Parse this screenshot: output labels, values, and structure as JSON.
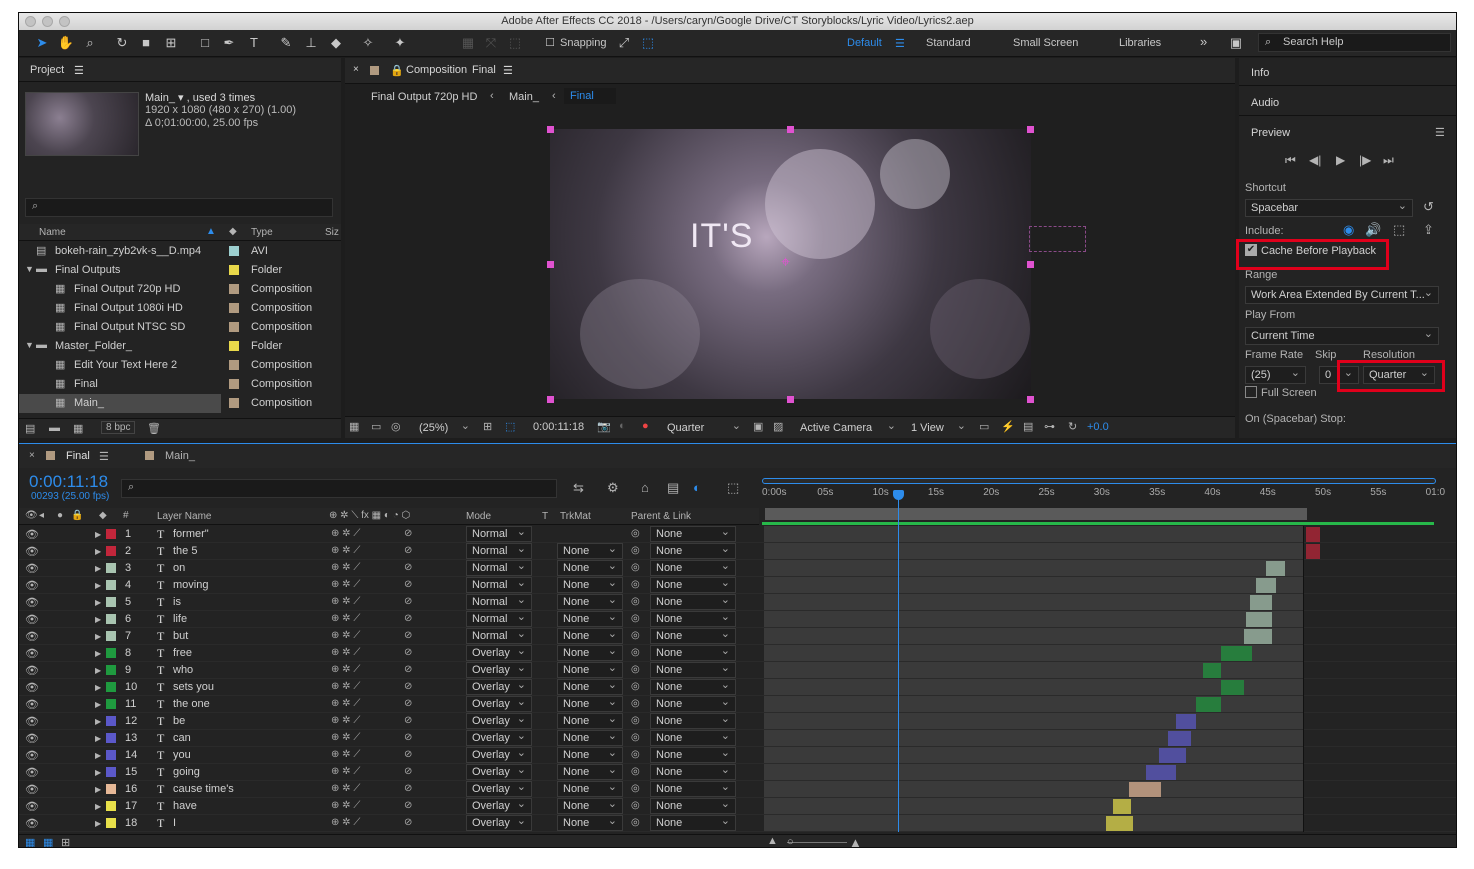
{
  "window": {
    "title": "Adobe After Effects CC 2018 - /Users/caryn/Google Drive/CT Storyblocks/Lyric Video/Lyrics2.aep"
  },
  "toolbar": {
    "snapping": "Snapping",
    "workspaces": [
      "Default",
      "Standard",
      "Small Screen",
      "Libraries"
    ],
    "more": "»",
    "search_placeholder": "Search Help"
  },
  "project": {
    "title": "Project",
    "item_name": "Main_ ▾ , used 3 times",
    "item_res": "1920 x 1080  (480 x 270) (1.00)",
    "item_dur": "Δ 0;01:00:00, 25.00 fps",
    "search": "",
    "col_name": "Name",
    "col_type": "Type",
    "col_size": "Siz",
    "items": [
      {
        "name": "bokeh-rain_zyb2vk-s__D.mp4",
        "type": "AVI",
        "color": "#9ccfcf",
        "indent": 0,
        "kind": "file"
      },
      {
        "name": "Final Outputs",
        "type": "Folder",
        "color": "#e8d84a",
        "indent": 0,
        "kind": "folder"
      },
      {
        "name": "Final Output 720p HD",
        "type": "Composition",
        "color": "#b09a80",
        "indent": 1,
        "kind": "comp"
      },
      {
        "name": "Final Output 1080i HD",
        "type": "Composition",
        "color": "#b09a80",
        "indent": 1,
        "kind": "comp"
      },
      {
        "name": "Final Output NTSC SD",
        "type": "Composition",
        "color": "#b09a80",
        "indent": 1,
        "kind": "comp"
      },
      {
        "name": "Master_Folder_",
        "type": "Folder",
        "color": "#e8d84a",
        "indent": 0,
        "kind": "folder"
      },
      {
        "name": "Edit Your Text Here 2",
        "type": "Composition",
        "color": "#b09a80",
        "indent": 1,
        "kind": "comp"
      },
      {
        "name": "Final",
        "type": "Composition",
        "color": "#b09a80",
        "indent": 1,
        "kind": "comp"
      },
      {
        "name": "Main_",
        "type": "Composition",
        "color": "#b09a80",
        "indent": 1,
        "kind": "comp"
      }
    ],
    "bpc": "8 bpc"
  },
  "comp": {
    "header": "Composition",
    "header_name": "Final",
    "breadcrumbs": [
      "Final Output 720p HD",
      "Main_",
      "Final"
    ],
    "overlay_text": "IT'S",
    "zoom": "(25%)",
    "timecode": "0:00:11:18",
    "resolution": "Quarter",
    "camera": "Active Camera",
    "views": "1 View",
    "exposure": "+0.0"
  },
  "right": {
    "info": "Info",
    "audio": "Audio",
    "preview": "Preview",
    "shortcut_label": "Shortcut",
    "shortcut": "Spacebar",
    "include": "Include:",
    "cache": "Cache Before Playback",
    "range_label": "Range",
    "range": "Work Area Extended By Current T...",
    "playfrom_label": "Play From",
    "playfrom": "Current Time",
    "framerate_label": "Frame Rate",
    "framerate": "(25)",
    "skip_label": "Skip",
    "skip": "0",
    "resolution_label": "Resolution",
    "resolution": "Quarter",
    "fullscreen": "Full Screen",
    "stop": "On (Spacebar) Stop:"
  },
  "timeline": {
    "tabs": [
      "Final",
      "Main_"
    ],
    "timecode": "0:00:11:18",
    "frames": "00293 (25.00 fps)",
    "col_layer": "Layer Name",
    "col_mode": "Mode",
    "col_t": "T",
    "col_trkmat": "TrkMat",
    "col_parent": "Parent & Link",
    "ruler": [
      "0:00s",
      "05s",
      "10s",
      "15s",
      "20s",
      "25s",
      "30s",
      "35s",
      "40s",
      "45s",
      "50s",
      "55s",
      "01:0"
    ],
    "layers": [
      {
        "n": "1",
        "name": "former\"",
        "mode": "Normal",
        "trk": "",
        "parent": "None",
        "color": "#c2263b",
        "bar": [
          1306,
          1320
        ]
      },
      {
        "n": "2",
        "name": "the 5",
        "mode": "Normal",
        "trk": "None",
        "parent": "None",
        "color": "#c2263b",
        "bar": [
          1306,
          1320
        ]
      },
      {
        "n": "3",
        "name": "on",
        "mode": "Normal",
        "trk": "None",
        "parent": "None",
        "color": "#a8c4b0",
        "bar": [
          1266,
          1285
        ]
      },
      {
        "n": "4",
        "name": "moving",
        "mode": "Normal",
        "trk": "None",
        "parent": "None",
        "color": "#a8c4b0",
        "bar": [
          1256,
          1276
        ]
      },
      {
        "n": "5",
        "name": "is",
        "mode": "Normal",
        "trk": "None",
        "parent": "None",
        "color": "#a8c4b0",
        "bar": [
          1250,
          1272
        ]
      },
      {
        "n": "6",
        "name": "life",
        "mode": "Normal",
        "trk": "None",
        "parent": "None",
        "color": "#a8c4b0",
        "bar": [
          1246,
          1272
        ]
      },
      {
        "n": "7",
        "name": "but",
        "mode": "Normal",
        "trk": "None",
        "parent": "None",
        "color": "#a8c4b0",
        "bar": [
          1244,
          1272
        ]
      },
      {
        "n": "8",
        "name": "free",
        "mode": "Overlay",
        "trk": "None",
        "parent": "None",
        "color": "#1f9a3f",
        "bar": [
          1221,
          1252
        ]
      },
      {
        "n": "9",
        "name": "who",
        "mode": "Overlay",
        "trk": "None",
        "parent": "None",
        "color": "#1f9a3f",
        "bar": [
          1203,
          1221
        ]
      },
      {
        "n": "10",
        "name": "sets you",
        "mode": "Overlay",
        "trk": "None",
        "parent": "None",
        "color": "#1f9a3f",
        "bar": [
          1221,
          1244
        ]
      },
      {
        "n": "11",
        "name": "the one",
        "mode": "Overlay",
        "trk": "None",
        "parent": "None",
        "color": "#1f9a3f",
        "bar": [
          1196,
          1221
        ]
      },
      {
        "n": "12",
        "name": "be",
        "mode": "Overlay",
        "trk": "None",
        "parent": "None",
        "color": "#5b58c9",
        "bar": [
          1176,
          1196
        ]
      },
      {
        "n": "13",
        "name": "can",
        "mode": "Overlay",
        "trk": "None",
        "parent": "None",
        "color": "#5b58c9",
        "bar": [
          1168,
          1191
        ]
      },
      {
        "n": "14",
        "name": "you",
        "mode": "Overlay",
        "trk": "None",
        "parent": "None",
        "color": "#5b58c9",
        "bar": [
          1159,
          1186
        ]
      },
      {
        "n": "15",
        "name": "going",
        "mode": "Overlay",
        "trk": "None",
        "parent": "None",
        "color": "#5b58c9",
        "bar": [
          1146,
          1176
        ]
      },
      {
        "n": "16",
        "name": "cause time's",
        "mode": "Overlay",
        "trk": "None",
        "parent": "None",
        "color": "#e6b897",
        "bar": [
          1129,
          1161
        ]
      },
      {
        "n": "17",
        "name": "have",
        "mode": "Overlay",
        "trk": "None",
        "parent": "None",
        "color": "#e8e04a",
        "bar": [
          1113,
          1131
        ]
      },
      {
        "n": "18",
        "name": "I",
        "mode": "Overlay",
        "trk": "None",
        "parent": "None",
        "color": "#e8e04a",
        "bar": [
          1106,
          1133
        ]
      }
    ]
  }
}
